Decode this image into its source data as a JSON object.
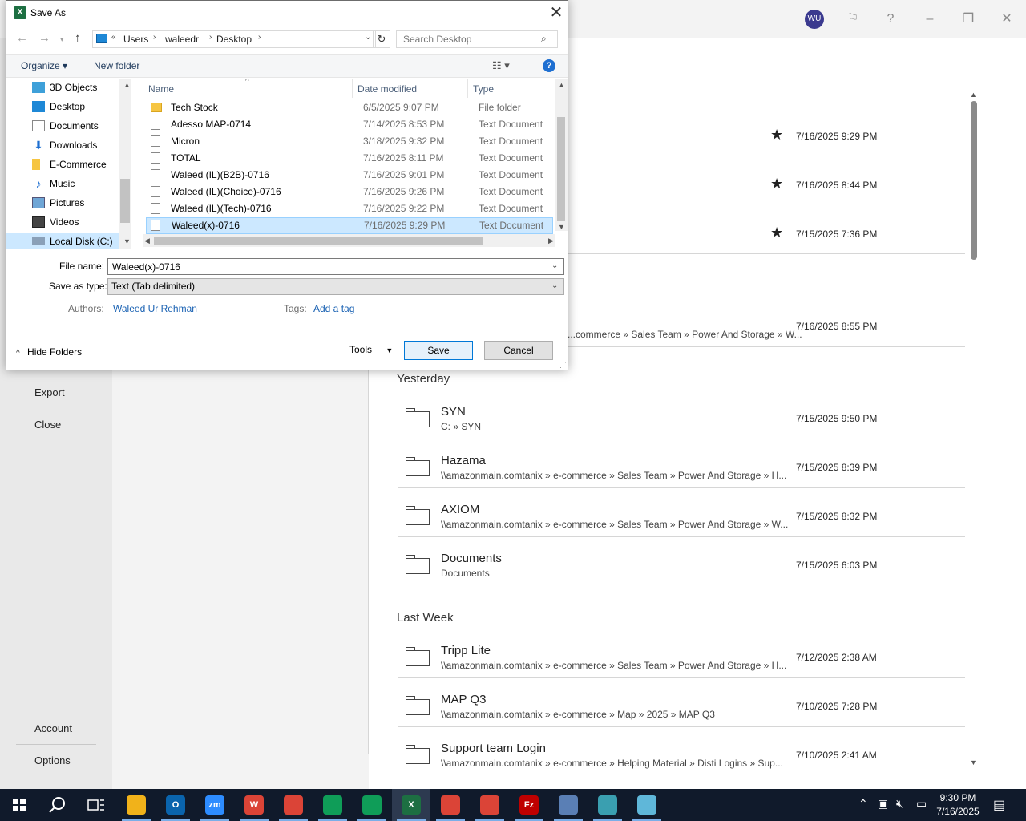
{
  "window": {
    "avatar_initials": "WU",
    "icons": [
      "feedback-icon",
      "help-icon",
      "minimize-icon",
      "restore-icon",
      "close-icon"
    ]
  },
  "backstage": {
    "left_nav": [
      "Export",
      "Close",
      "Account",
      "Options"
    ],
    "pinned_dates": [
      "7/16/2025 9:29 PM",
      "7/16/2025 8:44 PM",
      "7/15/2025 7:36 PM"
    ],
    "partial_item": {
      "path": "...commerce » Sales Team » Power And Storage » W...",
      "date": "7/16/2025 8:55 PM"
    },
    "groups": [
      {
        "heading": "Yesterday",
        "items": [
          {
            "title": "SYN",
            "path": "C: » SYN",
            "date": "7/15/2025 9:50 PM"
          },
          {
            "title": "Hazama",
            "path": "\\\\amazonmain.comtanix » e-commerce » Sales Team » Power And Storage » H...",
            "date": "7/15/2025 8:39 PM"
          },
          {
            "title": "AXIOM",
            "path": "\\\\amazonmain.comtanix » e-commerce » Sales Team » Power And Storage » W...",
            "date": "7/15/2025 8:32 PM"
          },
          {
            "title": "Documents",
            "path": "Documents",
            "date": "7/15/2025 6:03 PM"
          }
        ]
      },
      {
        "heading": "Last Week",
        "items": [
          {
            "title": "Tripp Lite",
            "path": "\\\\amazonmain.comtanix » e-commerce » Sales Team » Power And Storage » H...",
            "date": "7/12/2025 2:38 AM"
          },
          {
            "title": "MAP Q3",
            "path": "\\\\amazonmain.comtanix » e-commerce » Map » 2025 » MAP Q3",
            "date": "7/10/2025 7:28 PM"
          },
          {
            "title": "Support team Login",
            "path": "\\\\amazonmain.comtanix » e-commerce » Helping Material » Disti Logins » Sup...",
            "date": "7/10/2025 2:41 AM"
          }
        ]
      }
    ]
  },
  "dialog": {
    "title": "Save As",
    "address": {
      "overflow": "«",
      "segments": [
        "Users",
        "waleedr",
        "Desktop"
      ]
    },
    "search_placeholder": "Search Desktop",
    "organize_label": "Organize",
    "new_folder_label": "New folder",
    "nav_items": [
      "3D Objects",
      "Desktop",
      "Documents",
      "Downloads",
      "E-Commerce",
      "Music",
      "Pictures",
      "Videos",
      "Local Disk (C:)"
    ],
    "columns": {
      "name": "Name",
      "date": "Date modified",
      "type": "Type"
    },
    "files": [
      {
        "name": "Tech Stock",
        "date": "6/5/2025 9:07 PM",
        "type": "File folder"
      },
      {
        "name": "Adesso MAP-0714",
        "date": "7/14/2025 8:53 PM",
        "type": "Text Document"
      },
      {
        "name": "Micron",
        "date": "3/18/2025 9:32 PM",
        "type": "Text Document"
      },
      {
        "name": "TOTAL",
        "date": "7/16/2025 8:11 PM",
        "type": "Text Document"
      },
      {
        "name": "Waleed (IL)(B2B)-0716",
        "date": "7/16/2025 9:01 PM",
        "type": "Text Document"
      },
      {
        "name": "Waleed (IL)(Choice)-0716",
        "date": "7/16/2025 9:26 PM",
        "type": "Text Document"
      },
      {
        "name": "Waleed (IL)(Tech)-0716",
        "date": "7/16/2025 9:22 PM",
        "type": "Text Document"
      },
      {
        "name": "Waleed(x)-0716",
        "date": "7/16/2025 9:29 PM",
        "type": "Text Document"
      }
    ],
    "file_name_label": "File name:",
    "file_name_value": "Waleed(x)-0716",
    "save_type_label": "Save as type:",
    "save_type_value": "Text (Tab delimited)",
    "authors_label": "Authors:",
    "authors_value": "Waleed Ur Rehman",
    "tags_label": "Tags:",
    "tags_value": "Add a tag",
    "hide_folders_label": "Hide Folders",
    "tools_label": "Tools",
    "save_label": "Save",
    "cancel_label": "Cancel"
  },
  "taskbar": {
    "apps": [
      {
        "name": "file-explorer",
        "glyph": "",
        "color": "#f1b21a"
      },
      {
        "name": "outlook",
        "glyph": "O",
        "color": "#0a64ad"
      },
      {
        "name": "zoom",
        "glyph": "zm",
        "color": "#2d8cff"
      },
      {
        "name": "chrome-w",
        "glyph": "W",
        "color": "#db4437"
      },
      {
        "name": "chrome-2",
        "glyph": "",
        "color": "#db4437"
      },
      {
        "name": "chrome-3",
        "glyph": "",
        "color": "#0f9d58"
      },
      {
        "name": "chrome-4",
        "glyph": "",
        "color": "#0f9d58"
      },
      {
        "name": "excel",
        "glyph": "X",
        "color": "#1d6f42"
      },
      {
        "name": "chrome-5",
        "glyph": "",
        "color": "#db4437"
      },
      {
        "name": "chrome-6",
        "glyph": "",
        "color": "#db4437"
      },
      {
        "name": "filezilla",
        "glyph": "Fz",
        "color": "#bf0000"
      },
      {
        "name": "calculator",
        "glyph": "",
        "color": "#5a7fb5"
      },
      {
        "name": "app-diamond",
        "glyph": "",
        "color": "#3a9fb0"
      },
      {
        "name": "app-notebook",
        "glyph": "",
        "color": "#5fb7d9"
      }
    ],
    "time": "9:30 PM",
    "date": "7/16/2025"
  }
}
